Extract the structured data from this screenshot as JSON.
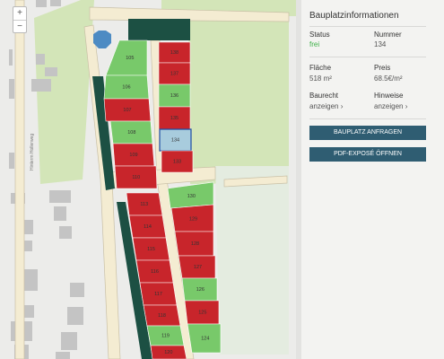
{
  "map": {
    "zoom_in_label": "+",
    "zoom_out_label": "−",
    "street_name": "Hinterm Hollerweg",
    "colors": {
      "free": "#78c96a",
      "sold": "#c8252b",
      "selected": "#a8ccdd",
      "hedge": "#1c5043",
      "road": "#f4ecd2",
      "field": "#d3e5b8",
      "building": "#c4c4c4"
    },
    "plots": [
      {
        "number": "138",
        "status": "sold"
      },
      {
        "number": "137",
        "status": "sold"
      },
      {
        "number": "136",
        "status": "free"
      },
      {
        "number": "135",
        "status": "sold"
      },
      {
        "number": "134",
        "status": "selected"
      },
      {
        "number": "133",
        "status": "sold"
      },
      {
        "number": "105",
        "status": "free"
      },
      {
        "number": "106",
        "status": "free"
      },
      {
        "number": "107",
        "status": "sold"
      },
      {
        "number": "108",
        "status": "free"
      },
      {
        "number": "109",
        "status": "sold"
      },
      {
        "number": "110",
        "status": "sold"
      },
      {
        "number": "130",
        "status": "free"
      },
      {
        "number": "129",
        "status": "sold"
      },
      {
        "number": "128",
        "status": "sold"
      },
      {
        "number": "127",
        "status": "sold"
      },
      {
        "number": "126",
        "status": "free"
      },
      {
        "number": "125",
        "status": "sold"
      },
      {
        "number": "124",
        "status": "free"
      },
      {
        "number": "113",
        "status": "sold"
      },
      {
        "number": "114",
        "status": "sold"
      },
      {
        "number": "115",
        "status": "sold"
      },
      {
        "number": "116",
        "status": "sold"
      },
      {
        "number": "117",
        "status": "sold"
      },
      {
        "number": "118",
        "status": "sold"
      },
      {
        "number": "119",
        "status": "free"
      },
      {
        "number": "120",
        "status": "sold"
      }
    ]
  },
  "panel": {
    "title": "Bauplatzinformationen",
    "status_label": "Status",
    "status_value": "frei",
    "number_label": "Nummer",
    "number_value": "134",
    "area_label": "Fläche",
    "area_value": "518 m²",
    "price_label": "Preis",
    "price_value": "68.5€/m²",
    "zoning_label": "Baurecht",
    "zoning_link": "anzeigen ›",
    "notes_label": "Hinweise",
    "notes_link": "anzeigen ›",
    "request_button": "BAUPLATZ ANFRAGEN",
    "pdf_button": "PDF-EXPOSÉ ÖFFNEN"
  }
}
